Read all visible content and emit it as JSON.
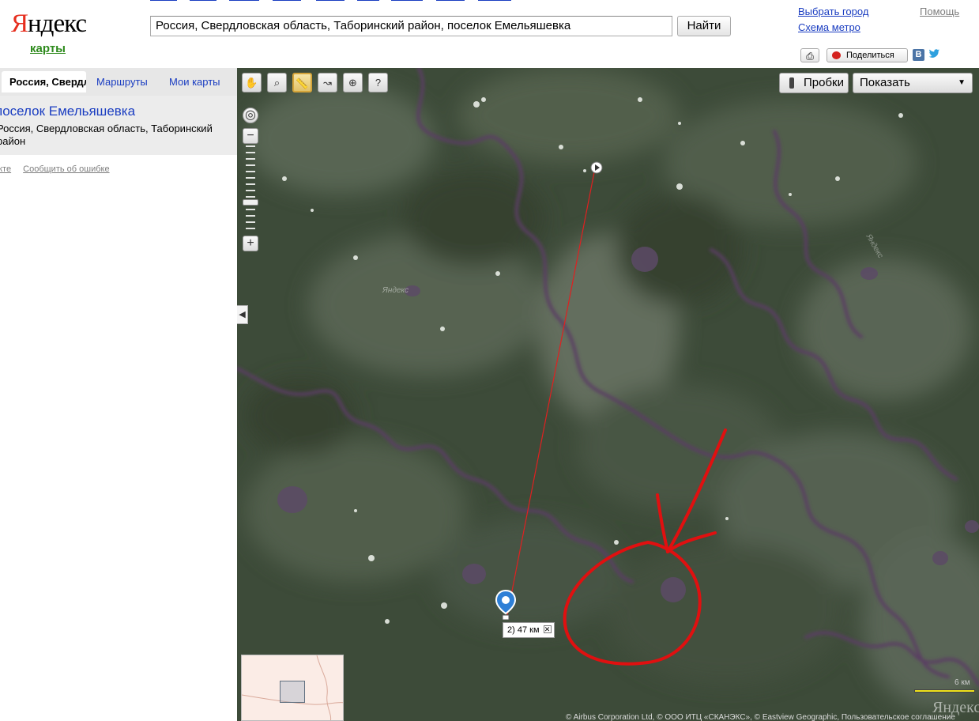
{
  "header": {
    "logo_ya": "Я",
    "logo_rest": "ндекс",
    "service": "карты",
    "search_value": "Россия, Свердловская область, Таборинский район, поселок Емельяшевка",
    "search_button": "Найти",
    "choose_city": "Выбрать город",
    "metro_map": "Схема метро",
    "help": "Помощь",
    "share": "Поделиться",
    "vk": "B"
  },
  "left_panel": {
    "tabs": [
      "Россия, Свердловская",
      "Маршруты",
      "Мои карты"
    ],
    "result_title": "поселок Емельяшевка",
    "result_address": "Россия, Свердловская область, Таборинский район",
    "result_links": [
      "екте",
      "Сообщить об ошибке"
    ]
  },
  "map": {
    "traffic_button": "Пробки",
    "show_select": "Показать",
    "distance_label": "2) 47 км",
    "watermark": "Яндекс",
    "scale_label": "6 км",
    "logo": "Яндекс",
    "copyright": "© Airbus Corporation Ltd, © ООО ИТЦ «СКАНЭКС», © Eastview Geographic, Пользовательское соглашение"
  }
}
